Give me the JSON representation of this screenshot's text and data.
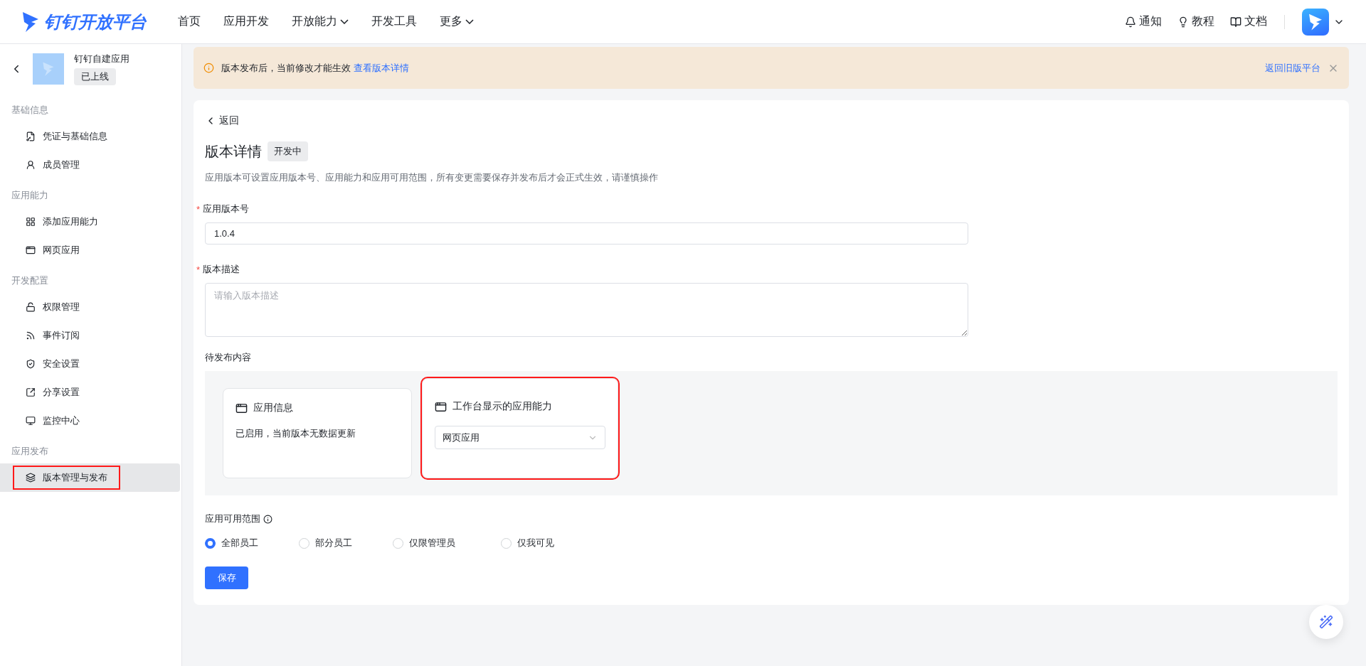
{
  "header": {
    "logo": "钉钉开放平台",
    "nav": [
      {
        "label": "首页",
        "dropdown": false
      },
      {
        "label": "应用开发",
        "dropdown": false
      },
      {
        "label": "开放能力",
        "dropdown": true
      },
      {
        "label": "开发工具",
        "dropdown": false
      },
      {
        "label": "更多",
        "dropdown": true
      }
    ],
    "links": [
      {
        "label": "通知",
        "kind": "bell"
      },
      {
        "label": "教程",
        "kind": "bulb"
      },
      {
        "label": "文档",
        "kind": "book"
      }
    ]
  },
  "sidebar": {
    "app_name": "钉钉自建应用",
    "app_status": "已上线",
    "sections": [
      {
        "title": "基础信息",
        "items": [
          {
            "label": "凭证与基础信息",
            "kind": "credential",
            "selected": false,
            "highlighted": false
          },
          {
            "label": "成员管理",
            "kind": "member",
            "selected": false,
            "highlighted": false
          }
        ]
      },
      {
        "title": "应用能力",
        "items": [
          {
            "label": "添加应用能力",
            "kind": "add",
            "selected": false,
            "highlighted": false
          },
          {
            "label": "网页应用",
            "kind": "window",
            "selected": false,
            "highlighted": false
          }
        ]
      },
      {
        "title": "开发配置",
        "items": [
          {
            "label": "权限管理",
            "kind": "lock",
            "selected": false,
            "highlighted": false
          },
          {
            "label": "事件订阅",
            "kind": "rss",
            "selected": false,
            "highlighted": false
          },
          {
            "label": "安全设置",
            "kind": "shield",
            "selected": false,
            "highlighted": false
          },
          {
            "label": "分享设置",
            "kind": "share",
            "selected": false,
            "highlighted": false
          },
          {
            "label": "监控中心",
            "kind": "monitor",
            "selected": false,
            "highlighted": false
          }
        ]
      },
      {
        "title": "应用发布",
        "items": [
          {
            "label": "版本管理与发布",
            "kind": "layers",
            "selected": true,
            "highlighted": true
          }
        ]
      }
    ]
  },
  "banner": {
    "text": "版本发布后，当前修改才能生效",
    "link": "查看版本详情",
    "right_link": "返回旧版平台"
  },
  "page": {
    "back": "返回",
    "title": "版本详情",
    "status": "开发中",
    "description": "应用版本可设置应用版本号、应用能力和应用可用范围，所有变更需要保存并发布后才会正式生效，请谨慎操作",
    "version_field": {
      "label": "应用版本号",
      "required_mark": "*",
      "value": "1.0.4"
    },
    "description_field": {
      "label": "版本描述",
      "required_mark": "*",
      "placeholder": "请输入版本描述"
    },
    "pending": {
      "title": "待发布内容",
      "cards": [
        {
          "kind": "text",
          "title": "应用信息",
          "text": "已启用，当前版本无数据更新",
          "highlighted": false
        },
        {
          "kind": "select",
          "title": "工作台显示的应用能力",
          "value": "网页应用",
          "highlighted": true
        }
      ]
    },
    "scope": {
      "label": "应用可用范围",
      "options": [
        {
          "label": "全部员工",
          "selected": true
        },
        {
          "label": "部分员工",
          "selected": false
        },
        {
          "label": "仅限管理员",
          "selected": false
        },
        {
          "label": "仅我可见",
          "selected": false
        }
      ]
    },
    "save": "保存"
  }
}
